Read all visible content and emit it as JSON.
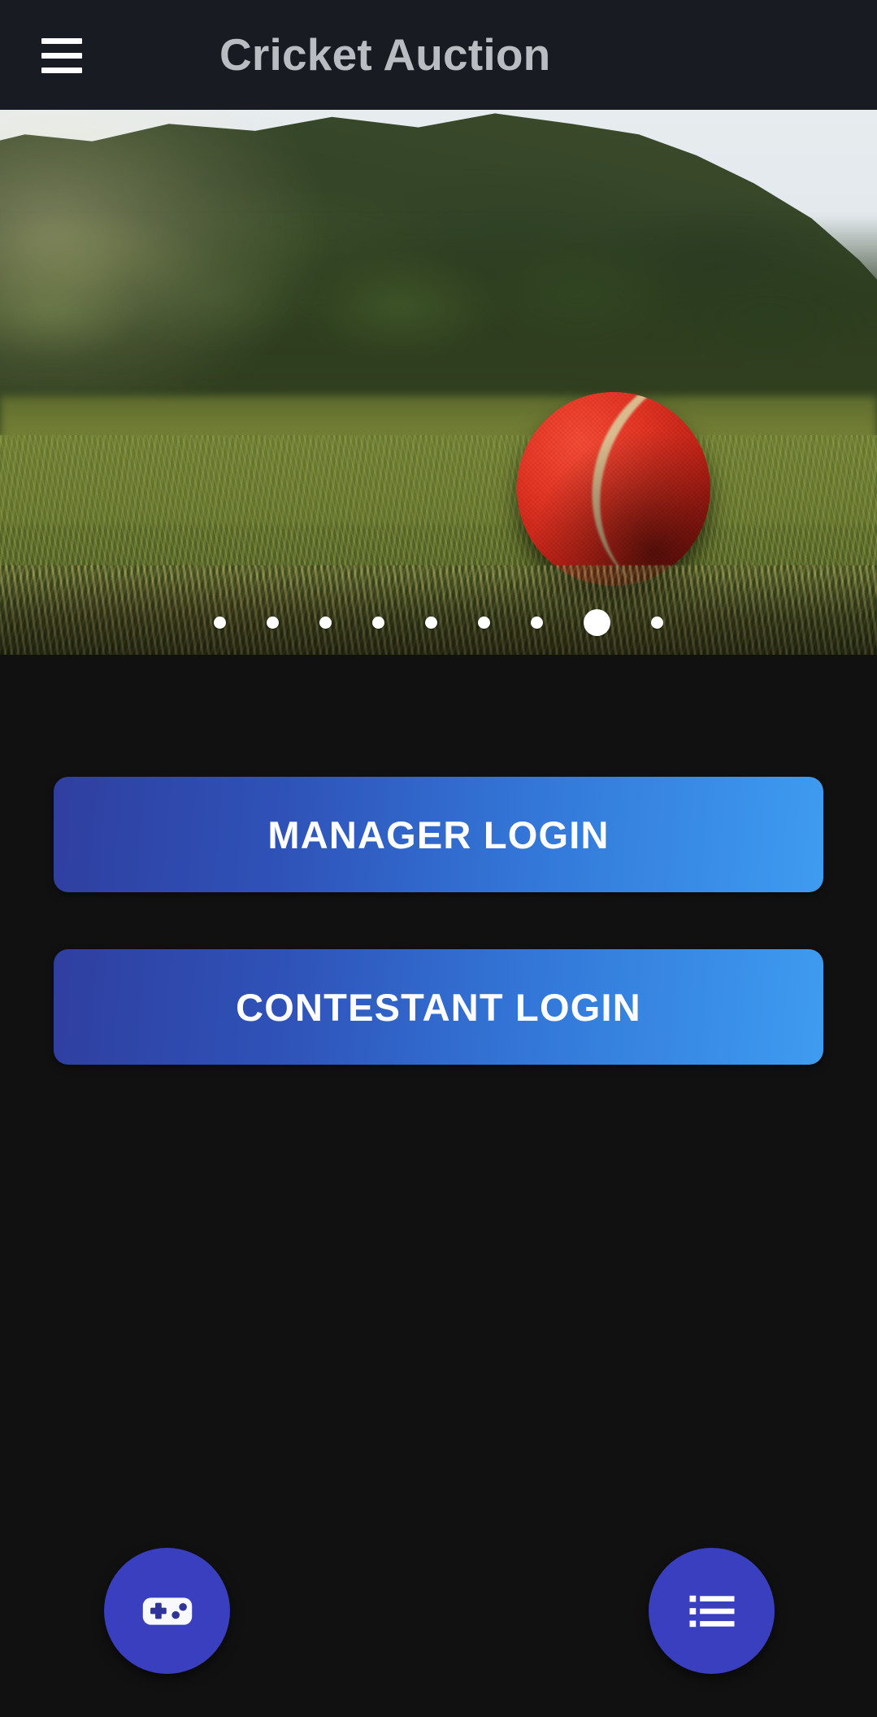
{
  "appbar": {
    "title": "Cricket Auction",
    "menu_icon": "hamburger-menu-icon",
    "menu_label": "Open navigation menu",
    "background_color": "#181C22",
    "title_color": "#B9BCC0"
  },
  "carousel": {
    "name": "hero-image-carousel",
    "slide_alt": "Red cricket ball resting on sunlit grass field with a forested hillside behind",
    "total_slides": 9,
    "active_slide": 8,
    "dots": [
      {
        "index": 1,
        "active": false
      },
      {
        "index": 2,
        "active": false
      },
      {
        "index": 3,
        "active": false
      },
      {
        "index": 4,
        "active": false
      },
      {
        "index": 5,
        "active": false
      },
      {
        "index": 6,
        "active": false
      },
      {
        "index": 7,
        "active": false
      },
      {
        "index": 8,
        "active": true
      },
      {
        "index": 9,
        "active": false
      }
    ],
    "dot_color": "#FFFFFF"
  },
  "main": {
    "buttons": [
      {
        "id": "manager-login",
        "label": "MANAGER LOGIN",
        "gradient_from": "#2F3FA0",
        "gradient_to": "#3E9CF0",
        "text_color": "#FFFFFF"
      },
      {
        "id": "contestant-login",
        "label": "CONTESTANT LOGIN",
        "gradient_from": "#2F3FA0",
        "gradient_to": "#3E9CF0",
        "text_color": "#FFFFFF"
      }
    ]
  },
  "floating_actions": [
    {
      "id": "game",
      "icon": "gamepad-icon",
      "label": "Game",
      "color": "#3A3FBF",
      "icon_color": "#F7F9FD"
    },
    {
      "id": "list",
      "icon": "list-icon",
      "label": "List",
      "color": "#3A3FBF",
      "icon_color": "#FFFFFF"
    }
  ],
  "theme": {
    "background_color": "#111111",
    "accent_color": "#3A3FBF"
  }
}
